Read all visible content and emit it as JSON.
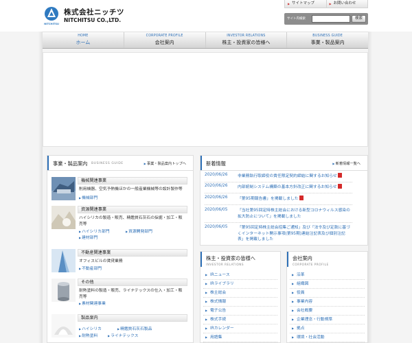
{
  "header": {
    "brand_jp": "株式会社ニッチツ",
    "brand_en": "NITCHITSU CO.,LTD.",
    "logo_text": "NITCHITSU",
    "util_links": [
      "サイトマップ",
      "お問い合わせ"
    ],
    "search_label": "サイト内検索",
    "search_button": "検索"
  },
  "nav": [
    {
      "en": "HOME",
      "jp": "ホーム"
    },
    {
      "en": "CORPORATE PROFILE",
      "jp": "会社案内"
    },
    {
      "en": "INVESTOR RELATIONS",
      "jp": "株主・投資家の皆様へ"
    },
    {
      "en": "BUSINESS GUIDE",
      "jp": "事業・製品案内"
    }
  ],
  "business": {
    "title": "事業・製品案内",
    "subtitle": "BUSINESS GUIDE",
    "top_link": "事業・製品案内トップへ",
    "items": [
      {
        "title": "機械関連事業",
        "desc": "削用機器、空気予熱機ほかの一般産業機械等の設計製作等",
        "links": [
          "機械部門"
        ]
      },
      {
        "title": "資源関連事業",
        "desc": "ハイシリカの製造・販売、精鑑質石灰石の採掘・加工・販売等",
        "links": [
          "ハイシリカ部門",
          "資源開発部門",
          "建材部門"
        ]
      },
      {
        "title": "不動産関連事業",
        "desc": "オフィスビルの賃貸業務",
        "links": [
          "不動産部門"
        ]
      },
      {
        "title": "その他",
        "desc": "耐熱塗料の製造・販売、ライナテックスの仕入・加工・販売等",
        "links": [
          "素材関連事業"
        ]
      },
      {
        "title": "製品案内",
        "desc": "",
        "links": [
          "ハイシリカ",
          "精鑑質石灰石製品",
          "耐熱塗料",
          "ライナテックス"
        ]
      }
    ]
  },
  "news": {
    "title": "新着情報",
    "list_link": "新着情報一覧へ",
    "items": [
      {
        "date": "2020/06/26",
        "text": "非業務執行取締役の責任限定契約締結に関するお知らせ"
      },
      {
        "date": "2020/06/26",
        "text": "内部統制システム構築の基本方針改正に関するお知らせ"
      },
      {
        "date": "2020/06/26",
        "text": "「第95期報告書」を掲載しました"
      },
      {
        "date": "2020/06/05",
        "text": "「当社第95回定時株主総会における新型コロナウィルス感染の拡大防止について」を掲載しました"
      },
      {
        "date": "2020/06/05",
        "text": "「第95回定時株主総会招集ご通知」及び「法令及び定款に基づくインターネット開示事項(第95期)連結注記表及び個別注記表」を掲載しました"
      }
    ]
  },
  "ir_box": {
    "title": "株主・投資家の皆様へ",
    "subtitle": "INVESTOR RELATIONS",
    "items": [
      "IRニュース",
      "IRライブラリ",
      "株主総会",
      "株式情報",
      "電子公告",
      "株式手続",
      "IRカレンダー",
      "用語集"
    ]
  },
  "corp_box": {
    "title": "会社案内",
    "subtitle": "CORPORATE PROFILE",
    "items": [
      "沿革",
      "組織図",
      "役員",
      "事業内容",
      "会社概要",
      "企業理念・行動規準",
      "拠点",
      "環境・社会活動"
    ]
  },
  "colors": {
    "accent": "#2d6fb6",
    "pdf": "#d42a2a"
  }
}
